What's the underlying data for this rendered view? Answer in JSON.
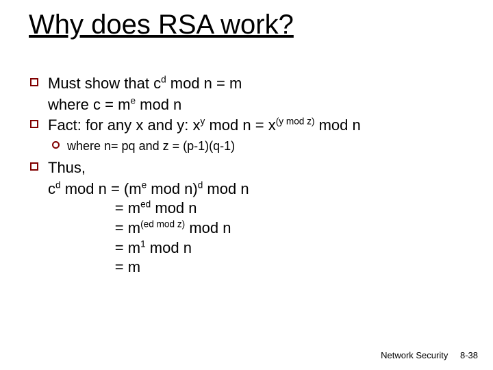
{
  "title": "Why does RSA work?",
  "bullets": {
    "b1_pre": "Must show that c",
    "b1_sup": "d",
    "b1_post": " mod n = m",
    "b1_cont_pre": "where c = m",
    "b1_cont_sup": "e",
    "b1_cont_post": " mod n",
    "b2_pre": "Fact: for any x and y: x",
    "b2_sup1": "y",
    "b2_mid": " mod n = x",
    "b2_sup2": "(y mod z)",
    "b2_post": " mod n",
    "sub1": "where n= pq and z = (p-1)(q-1)",
    "b3": "Thus,"
  },
  "eq": {
    "l1_a": "c",
    "l1_sup1": "d",
    "l1_b": " mod n = (m",
    "l1_sup2": "e",
    "l1_c": " mod n)",
    "l1_sup3": "d",
    "l1_d": " mod n",
    "l2_a": "                = m",
    "l2_sup": "ed",
    "l2_b": " mod n",
    "l3_a": "                = m",
    "l3_sup": "(ed mod z)",
    "l3_b": " mod n",
    "l4_a": "                = m",
    "l4_sup": "1",
    "l4_b": " mod n",
    "l5": "                = m"
  },
  "footer": {
    "course": "Network Security",
    "page": "8-38"
  }
}
